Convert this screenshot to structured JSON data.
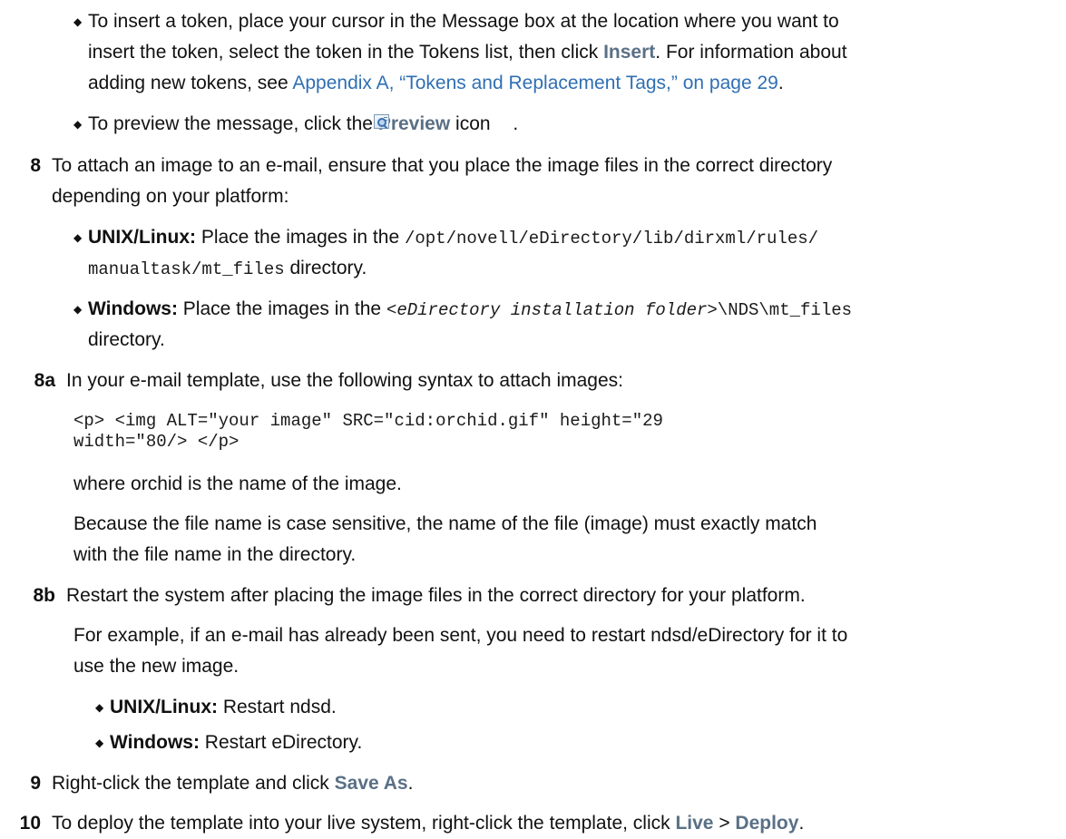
{
  "insert_bullet": {
    "line1": "To insert a token, place your cursor in the Message box at the location where you want to",
    "line2_a": "insert the token, select the token in the Tokens list, then click ",
    "line2_insert": "Insert",
    "line2_b": ". For information about",
    "line3_a": "adding new tokens, see ",
    "line3_link": "Appendix A, “Tokens and Replacement Tags,” on page 29",
    "line3_b": "."
  },
  "preview_bullet": {
    "text_a": "To preview the message, click the ",
    "preview": "Preview",
    "text_b": " icon ",
    "icon": "preview-icon",
    "text_c": "."
  },
  "step8": {
    "number": "8",
    "line1": "To attach an image to an e-mail, ensure that you place the image files in the correct directory",
    "line2": "depending on your platform:",
    "unix_label": "UNIX/Linux:",
    "unix_text_a": " Place the images in the ",
    "unix_path1": "/opt/novell/eDirectory/lib/dirxml/rules/",
    "unix_path2": "manualtask/mt_files",
    "unix_text_b": " directory.",
    "win_label": "Windows:",
    "win_text_a": " Place the images in the ",
    "win_path_italic": "<eDirectory installation folder>",
    "win_path": "\\NDS\\mt_files",
    "win_text_b": "directory."
  },
  "step8a": {
    "number": "8a",
    "text": "In your e-mail template, use the following syntax to attach images:",
    "code1": "<p> <img ALT=\"your image\" SRC=\"cid:orchid.gif\" height=\"29",
    "code2": "width=\"80/> </p>",
    "where": "where orchid is the name of the image.",
    "note1": "Because the file name is case sensitive, the name of the file (image) must exactly match",
    "note2": "with the file name in the directory."
  },
  "step8b": {
    "number": "8b",
    "text": "Restart the system after placing the image files in the correct directory for your platform.",
    "example1": "For example, if an e-mail has already been sent, you need to restart ndsd/eDirectory for it to",
    "example2": "use the new image.",
    "unix_label": "UNIX/Linux:",
    "unix_text": "  Restart ndsd.",
    "win_label": "Windows:",
    "win_text": " Restart eDirectory."
  },
  "step9": {
    "number": "9",
    "text_a": "Right-click the template and click ",
    "save_as": "Save As",
    "text_b": "."
  },
  "step10": {
    "number": "10",
    "text_a": "To deploy the template into your live system, right-click the template, click ",
    "live": "Live",
    "sep": " > ",
    "deploy": "Deploy",
    "text_b": "."
  },
  "bullet_glyph": "◆"
}
